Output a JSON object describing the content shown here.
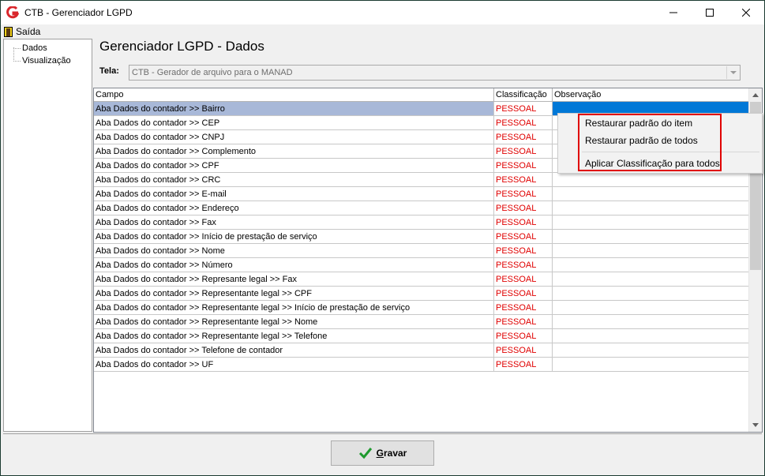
{
  "window": {
    "title": "CTB - Gerenciador LGPD",
    "controls": [
      "minimize-icon",
      "maximize-icon",
      "close-icon"
    ]
  },
  "menu": {
    "exit_label": "Saída",
    "exit_icon": "door-exit-icon"
  },
  "tree": {
    "items": [
      {
        "label": "Dados"
      },
      {
        "label": "Visualização"
      }
    ]
  },
  "page": {
    "title": "Gerenciador LGPD - Dados"
  },
  "tela": {
    "label": "Tela:",
    "value": "CTB - Gerador de arquivo para o MANAD"
  },
  "grid": {
    "headers": {
      "campo": "Campo",
      "classificacao": "Classificação",
      "observacao": "Observação"
    },
    "rows": [
      {
        "campo": "Aba Dados do contador >> Bairro",
        "classificacao": "PESSOAL",
        "observacao": ""
      },
      {
        "campo": "Aba Dados do contador >> CEP",
        "classificacao": "PESSOAL",
        "observacao": ""
      },
      {
        "campo": "Aba Dados do contador >> CNPJ",
        "classificacao": "PESSOAL",
        "observacao": ""
      },
      {
        "campo": "Aba Dados do contador >> Complemento",
        "classificacao": "PESSOAL",
        "observacao": ""
      },
      {
        "campo": "Aba Dados do contador >> CPF",
        "classificacao": "PESSOAL",
        "observacao": ""
      },
      {
        "campo": "Aba Dados do contador >> CRC",
        "classificacao": "PESSOAL",
        "observacao": ""
      },
      {
        "campo": "Aba Dados do contador >> E-mail",
        "classificacao": "PESSOAL",
        "observacao": ""
      },
      {
        "campo": "Aba Dados do contador >> Endereço",
        "classificacao": "PESSOAL",
        "observacao": ""
      },
      {
        "campo": "Aba Dados do contador >> Fax",
        "classificacao": "PESSOAL",
        "observacao": ""
      },
      {
        "campo": "Aba Dados do contador >> Início de prestação de serviço",
        "classificacao": "PESSOAL",
        "observacao": ""
      },
      {
        "campo": "Aba Dados do contador >> Nome",
        "classificacao": "PESSOAL",
        "observacao": ""
      },
      {
        "campo": "Aba Dados do contador >> Número",
        "classificacao": "PESSOAL",
        "observacao": ""
      },
      {
        "campo": "Aba Dados do contador >> Represante legal >> Fax",
        "classificacao": "PESSOAL",
        "observacao": ""
      },
      {
        "campo": "Aba Dados do contador >> Representante legal >> CPF",
        "classificacao": "PESSOAL",
        "observacao": ""
      },
      {
        "campo": "Aba Dados do contador >> Representante legal >> Início de prestação de serviço",
        "classificacao": "PESSOAL",
        "observacao": ""
      },
      {
        "campo": "Aba Dados do contador >> Representante legal >> Nome",
        "classificacao": "PESSOAL",
        "observacao": ""
      },
      {
        "campo": "Aba Dados do contador >> Representante legal >> Telefone",
        "classificacao": "PESSOAL",
        "observacao": ""
      },
      {
        "campo": "Aba Dados do contador >> Telefone de contador",
        "classificacao": "PESSOAL",
        "observacao": ""
      },
      {
        "campo": "Aba Dados do contador >> UF",
        "classificacao": "PESSOAL",
        "observacao": ""
      }
    ]
  },
  "context_menu": {
    "items": [
      {
        "label": "Restaurar padrão do item"
      },
      {
        "label": "Restaurar padrão de todos"
      },
      {
        "label": "Aplicar Classificação para todos"
      }
    ]
  },
  "footer": {
    "save_first_letter": "G",
    "save_rest": "ravar",
    "save_icon": "checkmark-icon"
  },
  "colors": {
    "classification_text": "#e00000",
    "selection_blue": "#0078d7",
    "highlight_box": "#e00000",
    "app_logo": "#d9262b"
  }
}
